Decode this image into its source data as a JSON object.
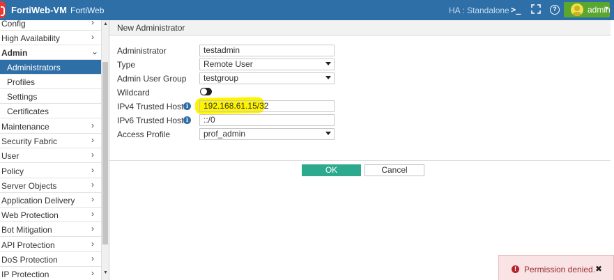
{
  "topbar": {
    "product": "FortiWeb-VM",
    "hostname": "FortiWeb",
    "ha_label": "HA :",
    "ha_value": "Standalone",
    "terminal_icon": ">_",
    "help_icon": "?",
    "user": "admin",
    "user_caret": "▾"
  },
  "sidebar": {
    "items": [
      {
        "label": "Config",
        "chevron": "›"
      },
      {
        "label": "High Availability",
        "chevron": "›"
      },
      {
        "label": "Admin",
        "chevron": "⌄"
      },
      {
        "label": "Administrators"
      },
      {
        "label": "Profiles"
      },
      {
        "label": "Settings"
      },
      {
        "label": "Certificates"
      },
      {
        "label": "Maintenance",
        "chevron": "›"
      },
      {
        "label": "Security Fabric",
        "chevron": "›"
      },
      {
        "label": "User",
        "chevron": "›"
      },
      {
        "label": "Policy",
        "chevron": "›"
      },
      {
        "label": "Server Objects",
        "chevron": "›"
      },
      {
        "label": "Application Delivery",
        "chevron": "›"
      },
      {
        "label": "Web Protection",
        "chevron": "›"
      },
      {
        "label": "Bot Mitigation",
        "chevron": "›"
      },
      {
        "label": "API Protection",
        "chevron": "›"
      },
      {
        "label": "DoS Protection",
        "chevron": "›"
      },
      {
        "label": "IP Protection",
        "chevron": "›"
      }
    ],
    "scroll_up": "▲",
    "scroll_down": "▼"
  },
  "form": {
    "title": "New Administrator",
    "administrator": {
      "label": "Administrator",
      "value": "testadmin"
    },
    "type": {
      "label": "Type",
      "value": "Remote User"
    },
    "admin_user_group": {
      "label": "Admin User Group",
      "value": "testgroup"
    },
    "wildcard": {
      "label": "Wildcard",
      "enabled": false
    },
    "ipv4_trusted_hosts": {
      "label": "IPv4 Trusted Hosts",
      "value": "192.168.61.15/32"
    },
    "ipv6_trusted_hosts": {
      "label": "IPv6 Trusted Hosts",
      "value": "::/0"
    },
    "access_profile": {
      "label": "Access Profile",
      "value": "prof_admin"
    },
    "info_icon": "i",
    "ok_label": "OK",
    "cancel_label": "Cancel"
  },
  "toast": {
    "icon": "!",
    "message": "Permission denied.",
    "close": "✖"
  },
  "colors": {
    "topbar": "#2e6fa7",
    "active_nav": "#2e6fa7",
    "ok_button": "#2daa8d",
    "user_box": "#5aa62f",
    "highlight": "#fff400",
    "toast_bg": "#f9e3e4"
  }
}
